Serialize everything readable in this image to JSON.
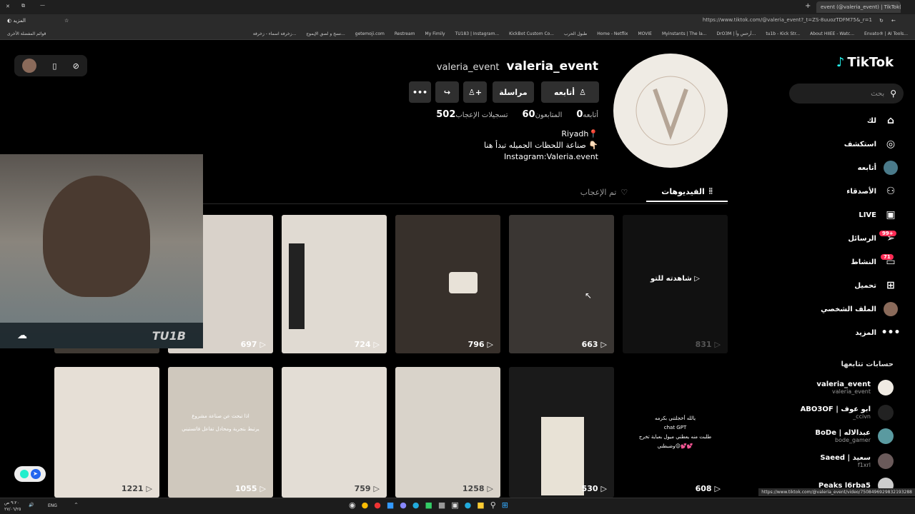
{
  "browser": {
    "tab_title": "event (@valeria_event) | TikTok(71)",
    "url": "https://www.tiktok.com/@valeria_event?_t=ZS-8uuozTDFM75&_r=1",
    "bookmarks": [
      "Envato® | AI Tools...",
      "About HIIEE - Watc...",
      "tu1b - Kick Str...",
      "DrO3M | أرحس وآ...",
      "Myinstants | The la...",
      "MOVIE",
      "Home - Netflix",
      "طبول الحرب",
      "KickBot Custom Co...",
      "TU183 | Instagram...",
      "My Fimily",
      "Restream",
      "getemoji.com",
      "نسخ و لصق الإيموج...",
      "زخرفة اسماء - زخرفة..."
    ],
    "bookmarks_other": "قوائم المفضلة الأخرى",
    "status_url": "https://www.tiktok.com/@valeria_event/video/7508496929832193288"
  },
  "sidebar": {
    "logo": "TikTok",
    "search_placeholder": "بحث",
    "nav": [
      {
        "label": "لك",
        "icon": "home-icon"
      },
      {
        "label": "استكشف",
        "icon": "compass-icon"
      },
      {
        "label": "أتابعه",
        "icon": "following-avatar-icon"
      },
      {
        "label": "الأصدقاء",
        "icon": "friends-icon"
      },
      {
        "label": "LIVE",
        "icon": "live-icon"
      },
      {
        "label": "الرسائل",
        "icon": "messages-icon",
        "badge": "99+"
      },
      {
        "label": "النشاط",
        "icon": "activity-icon",
        "badge": "71"
      },
      {
        "label": "تحميل",
        "icon": "upload-icon"
      },
      {
        "label": "الملف الشخصي",
        "icon": "profile-avatar-icon"
      },
      {
        "label": "المزيد",
        "icon": "more-icon"
      }
    ],
    "following_title": "حسابات تتابعها",
    "following": [
      {
        "name": "valeria_event",
        "handle": "valeria_event"
      },
      {
        "name": "ABO3OF | ابو عوف",
        "handle": "_ccivn"
      },
      {
        "name": "BoDe | عبدالاله",
        "handle": "bode_gamer"
      },
      {
        "name": "Saeed | سعيد",
        "handle": "f1xrl"
      },
      {
        "name": "Peaks l6rba5",
        "handle": ""
      }
    ]
  },
  "profile": {
    "display_name": "valeria_event",
    "username": "valeria_event",
    "buttons": {
      "follow": "أتابعه",
      "message": "مراسلة"
    },
    "stats": [
      {
        "label": "أتابعه",
        "value": "0"
      },
      {
        "label": "المتابعون",
        "value": "60"
      },
      {
        "label": "تسجيلات الإعجاب",
        "value": "502"
      }
    ],
    "bio": [
      "Riyadh📍",
      "صناعة اللحظات الجميله تبدأ هنا 👇🏻",
      "Instagram:Valeria.event"
    ],
    "tabs": {
      "videos": "الفيديوهات",
      "liked": "تم الإعجاب"
    }
  },
  "grid": {
    "row1": [
      "",
      "697",
      "724",
      "796",
      "663",
      "831"
    ],
    "row1_overlay": "شاهدته للتو",
    "row2": [
      "1221",
      "1055",
      "759",
      "1258",
      "530",
      "608"
    ],
    "row2_last_caption": [
      "يالله  أخجلتني بكرمه",
      "chat GPT",
      "طلبت منه يعطني ميول بعباية تخرج",
      "وضبطني😌💕💕"
    ],
    "overlay_text": [
      "اذا تبحث عن صناعة مشروع",
      "يرتبط بتجربة ومحادل تفاعل فاتستيني"
    ]
  },
  "webcam": {
    "logo_text": "TU1B"
  },
  "taskbar": {
    "time": "٩:٢٠ ص",
    "date": "٢٧/٠٦/٢٥",
    "lang": "ENG"
  }
}
